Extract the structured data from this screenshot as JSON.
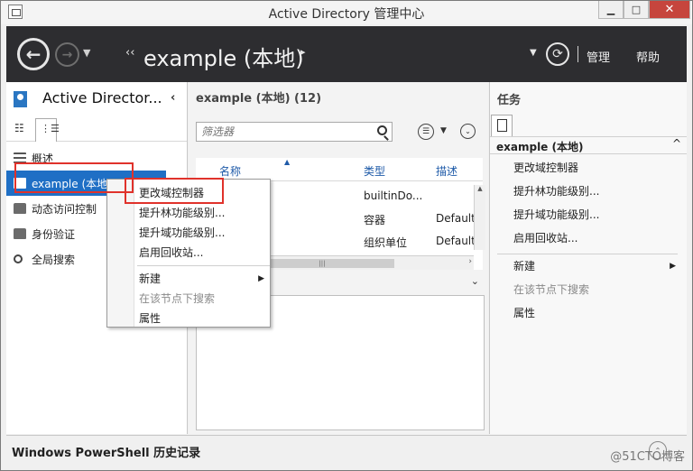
{
  "window": {
    "title": "Active Directory 管理中心",
    "min_label": "▁",
    "max_label": "□",
    "close_label": "✕"
  },
  "nav": {
    "back": "←",
    "forward": "→",
    "dropdown": "▼",
    "crumb_prev": "‹‹",
    "crumb": "example (本地)",
    "crumb_next": "▸",
    "dropdown2": "▼",
    "refresh": "⟳",
    "manage": "管理",
    "help": "帮助"
  },
  "left": {
    "title": "Active Director...",
    "collapse": "‹",
    "view_list_icon": "☷",
    "view_tree_icon": "⋮☰",
    "items": [
      {
        "label": "概述",
        "icon": "overview-icon"
      },
      {
        "label": "example (本地)",
        "icon": "domain-icon"
      },
      {
        "label": "动态访问控制",
        "icon": "folder-icon"
      },
      {
        "label": "身份验证",
        "icon": "folder-icon"
      },
      {
        "label": "全局搜索",
        "icon": "search-icon"
      }
    ]
  },
  "middle": {
    "title": "example (本地)  (12)",
    "filter_placeholder": "筛选器",
    "columns": [
      "名称",
      "类型",
      "描述"
    ],
    "rows": [
      {
        "name": "",
        "type": "builtinDo...",
        "desc": ""
      },
      {
        "name": "rs",
        "type": "容器",
        "desc": "Default"
      },
      {
        "name": "ontrollers",
        "type": "组织单位",
        "desc": "Default"
      }
    ],
    "hscroll_thumb": "|||",
    "preview_chevron": "⌄"
  },
  "tasks": {
    "title": "任务",
    "section": "example (本地)",
    "collapse": "^",
    "items": [
      {
        "label": "更改域控制器",
        "disabled": false,
        "sub": false
      },
      {
        "label": "提升林功能级别...",
        "disabled": false,
        "sub": false
      },
      {
        "label": "提升域功能级别...",
        "disabled": false,
        "sub": false
      },
      {
        "label": "启用回收站...",
        "disabled": false,
        "sub": false
      }
    ],
    "items2": [
      {
        "label": "新建",
        "disabled": false,
        "sub": true
      },
      {
        "label": "在该节点下搜索",
        "disabled": true,
        "sub": false
      },
      {
        "label": "属性",
        "disabled": false,
        "sub": false
      }
    ]
  },
  "context_menu": {
    "items": [
      {
        "label": "更改域控制器",
        "disabled": false
      },
      {
        "label": "提升林功能级别...",
        "disabled": false
      },
      {
        "label": "提升域功能级别...",
        "disabled": false
      },
      {
        "label": "启用回收站...",
        "disabled": false
      }
    ],
    "items2": [
      {
        "label": "新建",
        "disabled": false,
        "sub": true
      },
      {
        "label": "在该节点下搜索",
        "disabled": true
      },
      {
        "label": "属性",
        "disabled": false
      }
    ]
  },
  "bottom": {
    "powershell": "Windows PowerShell 历史记录",
    "expand": "⌃",
    "watermark": "@51CTO博客"
  },
  "colors": {
    "selection": "#1f6fc5",
    "navbar": "#2d2d30",
    "highlight": "#e0322b"
  }
}
